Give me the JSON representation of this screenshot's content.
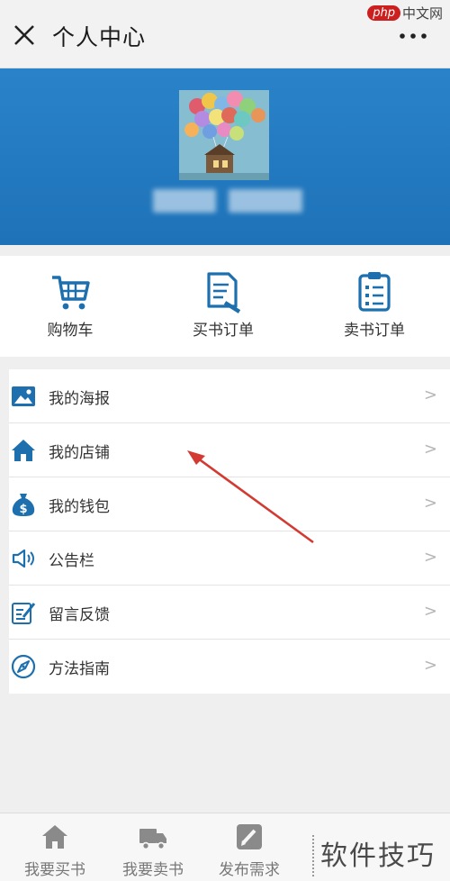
{
  "header": {
    "title": "个人中心",
    "close_icon": "close-icon",
    "more_icon": "more-dots-icon",
    "watermark_badge": "php",
    "watermark_text": "中文网"
  },
  "profile": {
    "avatar": "balloon-house-avatar",
    "name_blurred": true
  },
  "quick_actions": [
    {
      "label": "购物车",
      "icon": "cart-icon"
    },
    {
      "label": "买书订单",
      "icon": "edit-doc-icon"
    },
    {
      "label": "卖书订单",
      "icon": "clipboard-icon"
    }
  ],
  "menu": [
    {
      "label": "我的海报",
      "icon": "image-icon"
    },
    {
      "label": "我的店铺",
      "icon": "home-icon"
    },
    {
      "label": "我的钱包",
      "icon": "money-bag-icon"
    },
    {
      "label": "公告栏",
      "icon": "speaker-icon"
    },
    {
      "label": "留言反馈",
      "icon": "feedback-edit-icon"
    },
    {
      "label": "方法指南",
      "icon": "compass-icon"
    }
  ],
  "chevron": ">",
  "bottom_tabs": [
    {
      "label": "我要买书",
      "icon": "home-icon"
    },
    {
      "label": "我要卖书",
      "icon": "truck-icon"
    },
    {
      "label": "发布需求",
      "icon": "pencil-icon"
    }
  ],
  "bottom_watermark": "软件技巧",
  "colors": {
    "accent": "#1e73b8",
    "icon": "#1d6fae",
    "annotation": "#d23a32"
  }
}
